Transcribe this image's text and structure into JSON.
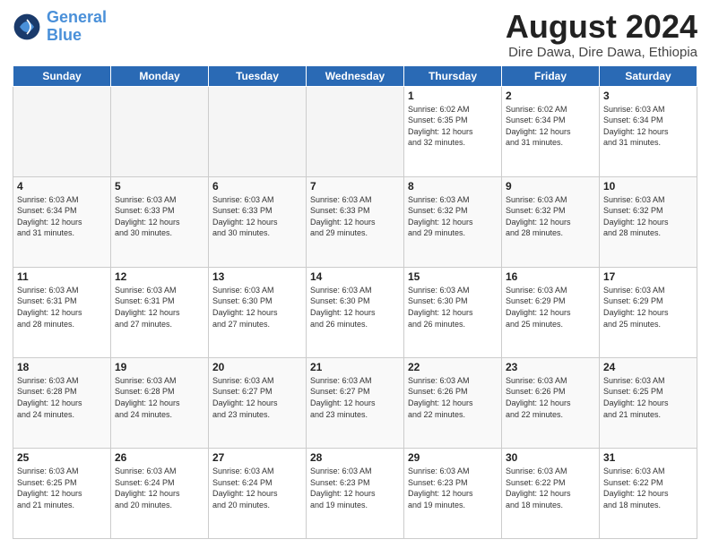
{
  "header": {
    "logo_general": "General",
    "logo_blue": "Blue",
    "month_year": "August 2024",
    "location": "Dire Dawa, Dire Dawa, Ethiopia"
  },
  "weekdays": [
    "Sunday",
    "Monday",
    "Tuesday",
    "Wednesday",
    "Thursday",
    "Friday",
    "Saturday"
  ],
  "weeks": [
    [
      {
        "day": "",
        "info": ""
      },
      {
        "day": "",
        "info": ""
      },
      {
        "day": "",
        "info": ""
      },
      {
        "day": "",
        "info": ""
      },
      {
        "day": "1",
        "info": "Sunrise: 6:02 AM\nSunset: 6:35 PM\nDaylight: 12 hours\nand 32 minutes."
      },
      {
        "day": "2",
        "info": "Sunrise: 6:02 AM\nSunset: 6:34 PM\nDaylight: 12 hours\nand 31 minutes."
      },
      {
        "day": "3",
        "info": "Sunrise: 6:03 AM\nSunset: 6:34 PM\nDaylight: 12 hours\nand 31 minutes."
      }
    ],
    [
      {
        "day": "4",
        "info": "Sunrise: 6:03 AM\nSunset: 6:34 PM\nDaylight: 12 hours\nand 31 minutes."
      },
      {
        "day": "5",
        "info": "Sunrise: 6:03 AM\nSunset: 6:33 PM\nDaylight: 12 hours\nand 30 minutes."
      },
      {
        "day": "6",
        "info": "Sunrise: 6:03 AM\nSunset: 6:33 PM\nDaylight: 12 hours\nand 30 minutes."
      },
      {
        "day": "7",
        "info": "Sunrise: 6:03 AM\nSunset: 6:33 PM\nDaylight: 12 hours\nand 29 minutes."
      },
      {
        "day": "8",
        "info": "Sunrise: 6:03 AM\nSunset: 6:32 PM\nDaylight: 12 hours\nand 29 minutes."
      },
      {
        "day": "9",
        "info": "Sunrise: 6:03 AM\nSunset: 6:32 PM\nDaylight: 12 hours\nand 28 minutes."
      },
      {
        "day": "10",
        "info": "Sunrise: 6:03 AM\nSunset: 6:32 PM\nDaylight: 12 hours\nand 28 minutes."
      }
    ],
    [
      {
        "day": "11",
        "info": "Sunrise: 6:03 AM\nSunset: 6:31 PM\nDaylight: 12 hours\nand 28 minutes."
      },
      {
        "day": "12",
        "info": "Sunrise: 6:03 AM\nSunset: 6:31 PM\nDaylight: 12 hours\nand 27 minutes."
      },
      {
        "day": "13",
        "info": "Sunrise: 6:03 AM\nSunset: 6:30 PM\nDaylight: 12 hours\nand 27 minutes."
      },
      {
        "day": "14",
        "info": "Sunrise: 6:03 AM\nSunset: 6:30 PM\nDaylight: 12 hours\nand 26 minutes."
      },
      {
        "day": "15",
        "info": "Sunrise: 6:03 AM\nSunset: 6:30 PM\nDaylight: 12 hours\nand 26 minutes."
      },
      {
        "day": "16",
        "info": "Sunrise: 6:03 AM\nSunset: 6:29 PM\nDaylight: 12 hours\nand 25 minutes."
      },
      {
        "day": "17",
        "info": "Sunrise: 6:03 AM\nSunset: 6:29 PM\nDaylight: 12 hours\nand 25 minutes."
      }
    ],
    [
      {
        "day": "18",
        "info": "Sunrise: 6:03 AM\nSunset: 6:28 PM\nDaylight: 12 hours\nand 24 minutes."
      },
      {
        "day": "19",
        "info": "Sunrise: 6:03 AM\nSunset: 6:28 PM\nDaylight: 12 hours\nand 24 minutes."
      },
      {
        "day": "20",
        "info": "Sunrise: 6:03 AM\nSunset: 6:27 PM\nDaylight: 12 hours\nand 23 minutes."
      },
      {
        "day": "21",
        "info": "Sunrise: 6:03 AM\nSunset: 6:27 PM\nDaylight: 12 hours\nand 23 minutes."
      },
      {
        "day": "22",
        "info": "Sunrise: 6:03 AM\nSunset: 6:26 PM\nDaylight: 12 hours\nand 22 minutes."
      },
      {
        "day": "23",
        "info": "Sunrise: 6:03 AM\nSunset: 6:26 PM\nDaylight: 12 hours\nand 22 minutes."
      },
      {
        "day": "24",
        "info": "Sunrise: 6:03 AM\nSunset: 6:25 PM\nDaylight: 12 hours\nand 21 minutes."
      }
    ],
    [
      {
        "day": "25",
        "info": "Sunrise: 6:03 AM\nSunset: 6:25 PM\nDaylight: 12 hours\nand 21 minutes."
      },
      {
        "day": "26",
        "info": "Sunrise: 6:03 AM\nSunset: 6:24 PM\nDaylight: 12 hours\nand 20 minutes."
      },
      {
        "day": "27",
        "info": "Sunrise: 6:03 AM\nSunset: 6:24 PM\nDaylight: 12 hours\nand 20 minutes."
      },
      {
        "day": "28",
        "info": "Sunrise: 6:03 AM\nSunset: 6:23 PM\nDaylight: 12 hours\nand 19 minutes."
      },
      {
        "day": "29",
        "info": "Sunrise: 6:03 AM\nSunset: 6:23 PM\nDaylight: 12 hours\nand 19 minutes."
      },
      {
        "day": "30",
        "info": "Sunrise: 6:03 AM\nSunset: 6:22 PM\nDaylight: 12 hours\nand 18 minutes."
      },
      {
        "day": "31",
        "info": "Sunrise: 6:03 AM\nSunset: 6:22 PM\nDaylight: 12 hours\nand 18 minutes."
      }
    ]
  ]
}
